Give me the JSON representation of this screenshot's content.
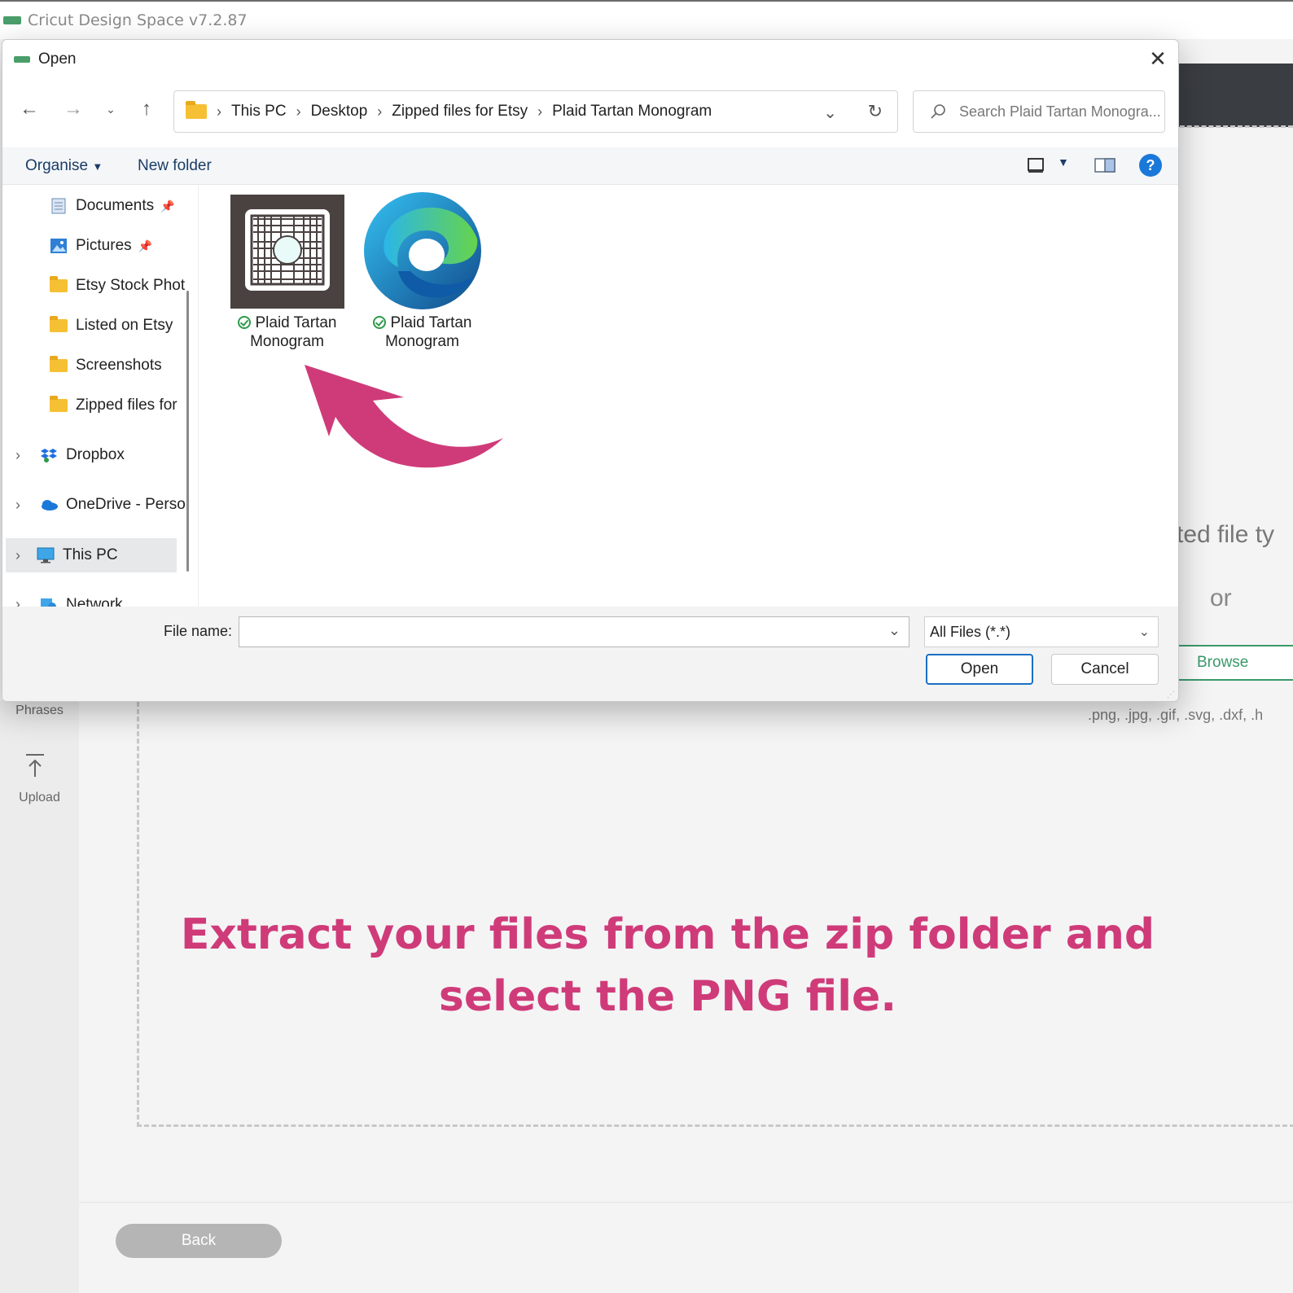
{
  "app": {
    "title": "Cricut Design Space  v7.2.87",
    "sidebar": {
      "phrases_label": "Phrases",
      "upload_label": "Upload"
    },
    "upload_panel": {
      "partial_text": "ted file ty",
      "or_text": "or",
      "browse_label": "Browse",
      "filetypes": ".png, .jpg, .gif, .svg, .dxf, .h"
    },
    "back_label": "Back"
  },
  "dialog": {
    "title": "Open",
    "breadcrumb": [
      "This PC",
      "Desktop",
      "Zipped files for Etsy",
      "Plaid Tartan Monogram"
    ],
    "search_placeholder": "Search Plaid Tartan Monogra...",
    "toolbar": {
      "organise": "Organise",
      "new_folder": "New folder"
    },
    "nav_items": [
      {
        "label": "Documents",
        "icon": "documents-icon",
        "pinned": true
      },
      {
        "label": "Pictures",
        "icon": "pictures-icon",
        "pinned": true
      },
      {
        "label": "Etsy Stock Phot",
        "icon": "folder-icon"
      },
      {
        "label": "Listed on Etsy",
        "icon": "folder-icon"
      },
      {
        "label": "Screenshots",
        "icon": "folder-icon"
      },
      {
        "label": "Zipped files for",
        "icon": "folder-icon"
      },
      {
        "label": "Dropbox",
        "icon": "dropbox-icon"
      },
      {
        "label": "OneDrive - Perso",
        "icon": "onedrive-icon"
      },
      {
        "label": "This PC",
        "icon": "pc-icon",
        "selected": true
      },
      {
        "label": "Network",
        "icon": "network-icon"
      }
    ],
    "files": [
      {
        "name_line1": "Plaid Tartan",
        "name_line2": "Monogram",
        "type": "png-thumbnail"
      },
      {
        "name_line1": "Plaid Tartan",
        "name_line2": "Monogram",
        "type": "edge-document"
      }
    ],
    "file_name_label": "File name:",
    "file_name_value": "",
    "filter_value": "All Files (*.*)",
    "open_label": "Open",
    "cancel_label": "Cancel"
  },
  "annotation": {
    "instruction": "Extract your files from the zip folder and select the PNG file."
  },
  "colors": {
    "accent_pink": "#cf3b79",
    "cricut_green": "#3a9a6a",
    "windows_blue": "#1a6fc4"
  }
}
